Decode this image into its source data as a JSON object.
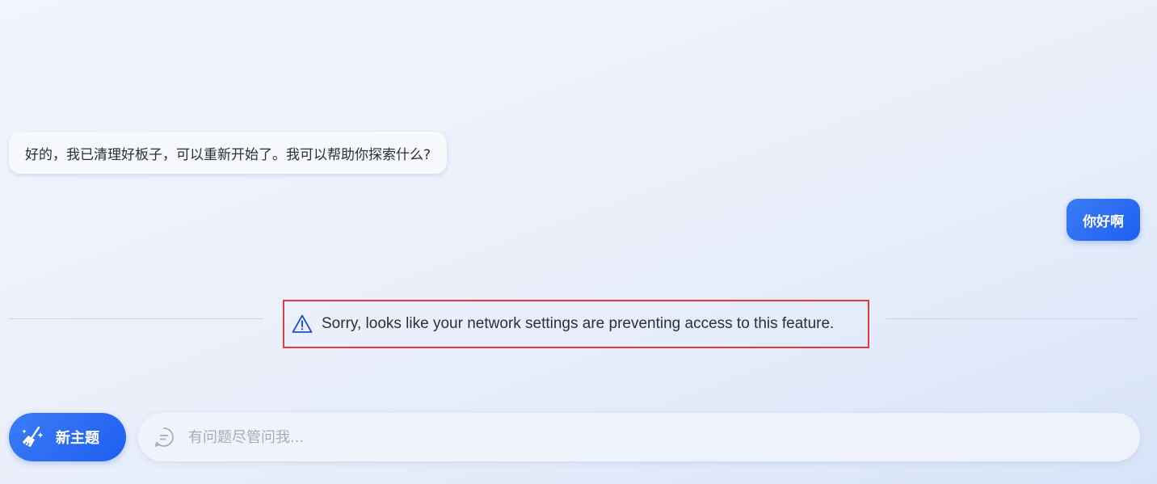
{
  "chat": {
    "bot_message": "好的，我已清理好板子，可以重新开始了。我可以帮助你探索什么?",
    "user_message": "你好啊"
  },
  "notice": {
    "icon": "warning-triangle-icon",
    "text": "Sorry, looks like your network settings are preventing access to this feature.",
    "icon_color": "#1f4fd0",
    "highlight_color": "#e5393f"
  },
  "footer": {
    "new_topic_label": "新主题",
    "new_topic_icon": "broom-sparkle-icon",
    "input_icon": "chat-bubble-icon",
    "input_placeholder": "有问题尽管问我...",
    "input_value": ""
  },
  "colors": {
    "accent": "#1f5ff0",
    "bubble_bg": "#f7f8fc"
  }
}
